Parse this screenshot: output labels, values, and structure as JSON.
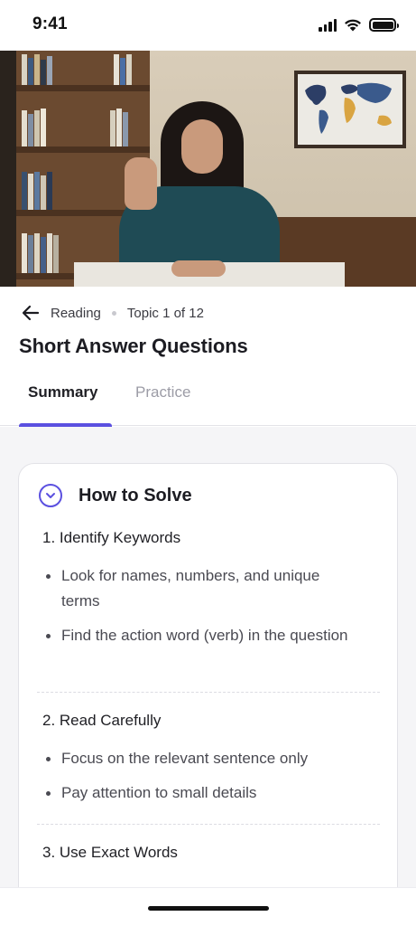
{
  "status_bar": {
    "time": "9:41"
  },
  "video": {
    "description_icon": "video-thumbnail"
  },
  "breadcrumb": {
    "section": "Reading",
    "topic": "Topic 1 of 12"
  },
  "page": {
    "title": "Short Answer Questions"
  },
  "tabs": [
    {
      "label": "Summary",
      "active": true
    },
    {
      "label": "Practice",
      "active": false
    }
  ],
  "card": {
    "title": "How to Solve",
    "steps": [
      {
        "title": "1. Identify Keywords",
        "bullets": [
          "Look for names, numbers, and unique terms",
          "Find the action word (verb) in the question"
        ]
      },
      {
        "title": "2. Read Carefully",
        "bullets": [
          "Focus on the relevant sentence only",
          "Pay attention to small details"
        ]
      },
      {
        "title": "3. Use Exact Words",
        "bullets": []
      }
    ]
  },
  "colors": {
    "accent": "#5b50e0",
    "text": "#1f1f24",
    "muted": "#9c9ca6"
  }
}
